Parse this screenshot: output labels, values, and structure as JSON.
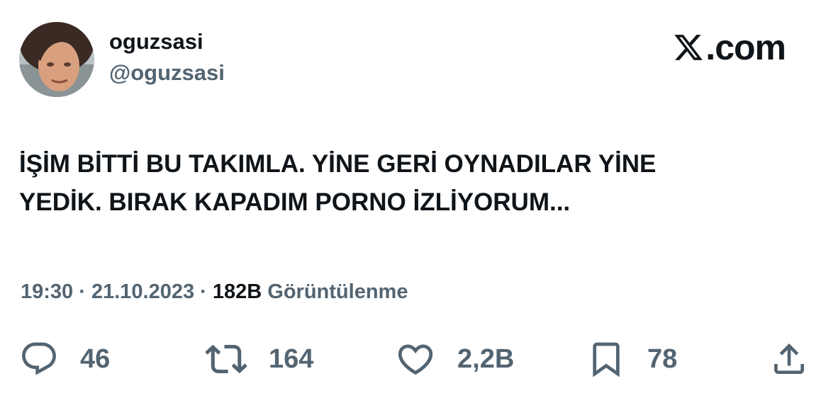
{
  "author": {
    "display_name": "oguzsasi",
    "handle": "@oguzsasi",
    "avatar_icon": "avatar"
  },
  "brand": {
    "icon": "x-logo-icon",
    "text": ".com"
  },
  "tweet": {
    "text": "İŞİM BİTTİ BU TAKIMLA. YİNE GERİ OYNADILAR YİNE\nYEDİK. BIRAK KAPADIM PORNO İZLİYORUM..."
  },
  "meta": {
    "time": "19:30",
    "separator1": " · ",
    "date": "21.10.2023",
    "separator2": " · ",
    "views_count": "182B",
    "views_label": " Görüntülenme"
  },
  "actions": {
    "reply": {
      "icon": "reply-icon",
      "count": "46"
    },
    "retweet": {
      "icon": "retweet-icon",
      "count": "164"
    },
    "like": {
      "icon": "heart-icon",
      "count": "2,2B"
    },
    "bookmark": {
      "icon": "bookmark-icon",
      "count": "78"
    },
    "share": {
      "icon": "share-icon"
    }
  },
  "colors": {
    "text_primary": "#0f1419",
    "text_secondary": "#536471",
    "background": "#ffffff"
  }
}
